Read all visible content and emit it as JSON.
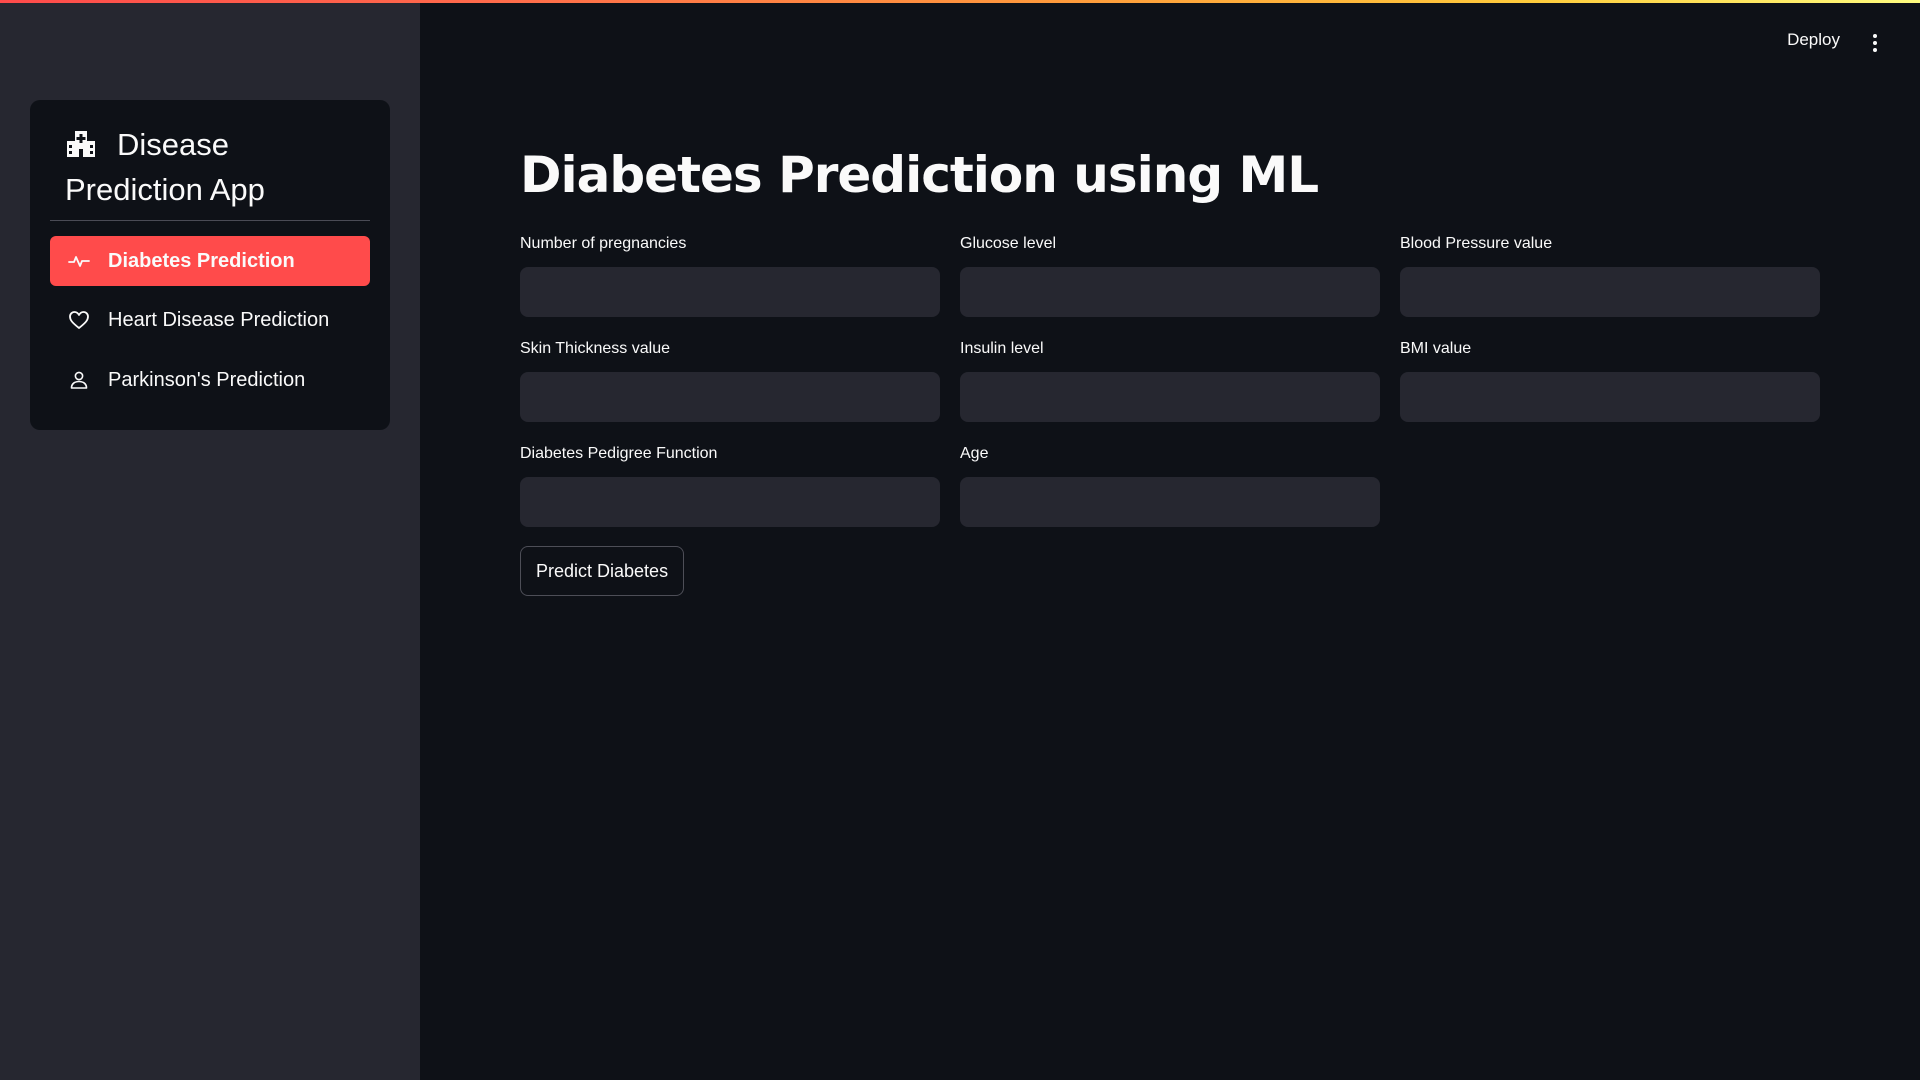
{
  "app": {
    "title": "Disease Prediction App",
    "accent_color": "#ff4b4b"
  },
  "sidebar": {
    "title_icon": "hospital-icon",
    "items": [
      {
        "label": "Diabetes Prediction",
        "icon": "activity-icon",
        "active": true
      },
      {
        "label": "Heart Disease Prediction",
        "icon": "heart-icon",
        "active": false
      },
      {
        "label": "Parkinson's Prediction",
        "icon": "person-icon",
        "active": false
      }
    ]
  },
  "header": {
    "deploy_label": "Deploy",
    "menu_icon": "more-vertical-icon"
  },
  "main": {
    "title": "Diabetes Prediction using ML",
    "fields": [
      {
        "label": "Number of pregnancies",
        "value": ""
      },
      {
        "label": "Glucose level",
        "value": ""
      },
      {
        "label": "Blood Pressure value",
        "value": ""
      },
      {
        "label": "Skin Thickness value",
        "value": ""
      },
      {
        "label": "Insulin level",
        "value": ""
      },
      {
        "label": "BMI value",
        "value": ""
      },
      {
        "label": "Diabetes Pedigree Function",
        "value": ""
      },
      {
        "label": "Age",
        "value": ""
      }
    ],
    "predict_button_label": "Predict Diabetes"
  }
}
